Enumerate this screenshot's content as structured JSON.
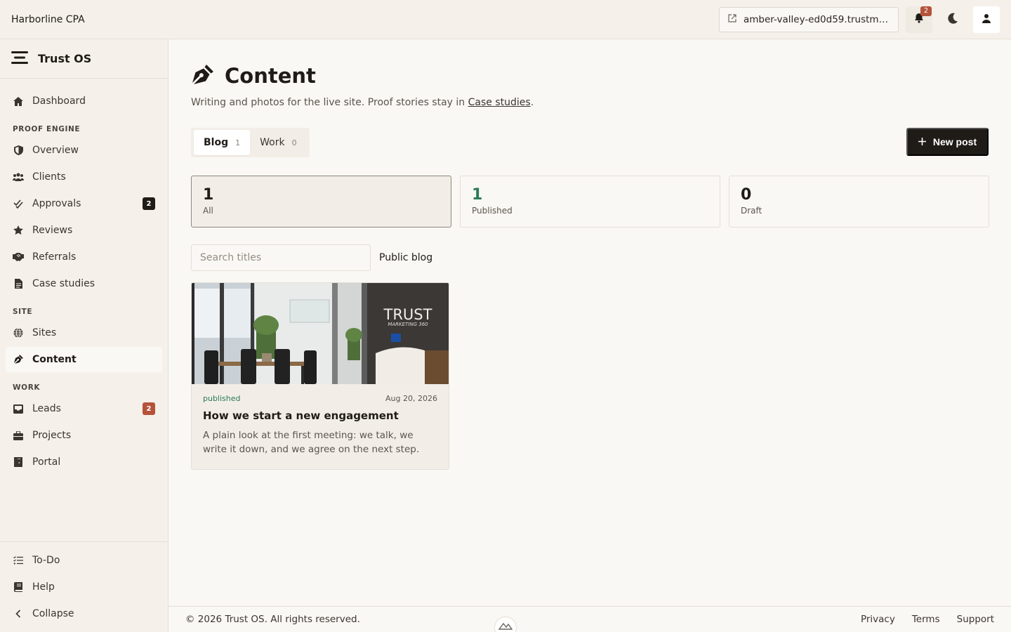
{
  "topbar": {
    "org_name": "Harborline CPA",
    "site_link": "amber-valley-ed0d59.trustmar...",
    "notifications_count": "2"
  },
  "sidebar": {
    "brand": "Trust OS",
    "dashboard": "Dashboard",
    "sections": {
      "proof_engine": "PROOF ENGINE",
      "site": "SITE",
      "work": "WORK"
    },
    "proof_engine_items": [
      {
        "label": "Overview"
      },
      {
        "label": "Clients"
      },
      {
        "label": "Approvals",
        "badge": "2"
      },
      {
        "label": "Reviews"
      },
      {
        "label": "Referrals"
      },
      {
        "label": "Case studies"
      }
    ],
    "site_items": [
      {
        "label": "Sites"
      },
      {
        "label": "Content"
      }
    ],
    "work_items": [
      {
        "label": "Leads",
        "badge": "2"
      },
      {
        "label": "Projects"
      },
      {
        "label": "Portal"
      }
    ],
    "bottom_items": [
      {
        "label": "To-Do"
      },
      {
        "label": "Help"
      },
      {
        "label": "Collapse"
      }
    ]
  },
  "page": {
    "title": "Content",
    "subtitle_text": "Writing and photos for the live site. Proof stories stay in",
    "subtitle_link": "Case studies",
    "subtitle_end": "."
  },
  "tabs": [
    {
      "label": "Blog",
      "count": "1"
    },
    {
      "label": "Work",
      "count": "0"
    }
  ],
  "new_post_label": "New post",
  "stats": [
    {
      "value": "1",
      "label": "All"
    },
    {
      "value": "1",
      "label": "Published"
    },
    {
      "value": "0",
      "label": "Draft"
    }
  ],
  "search": {
    "placeholder": "Search titles",
    "value": ""
  },
  "public_blog_label": "Public blog",
  "posts": [
    {
      "status": "published",
      "date": "Aug 20, 2026",
      "title": "How we start a new engagement",
      "excerpt": "A plain look at the first meeting: we talk, we write it down, and we agree on the next step.",
      "image_sign_line1": "TRUST",
      "image_sign_line2": "MARKETING 360"
    }
  ],
  "footer": {
    "copyright": "© 2026 Trust OS. All rights reserved.",
    "links": [
      "Privacy",
      "Terms",
      "Support"
    ]
  },
  "colors": {
    "accent_dark": "#1f1c18",
    "badge_rust": "#b5533a",
    "published_green": "#2a7a55",
    "background": "#faf8f4",
    "sidebar_bg": "#f5f1ea"
  }
}
